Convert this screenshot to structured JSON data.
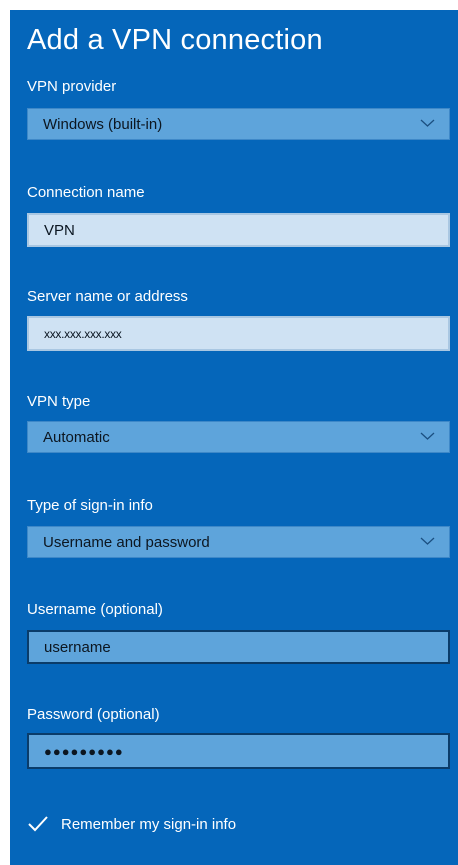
{
  "dialog": {
    "title": "Add a VPN connection"
  },
  "vpn_provider": {
    "label": "VPN provider",
    "value": "Windows (built-in)"
  },
  "connection_name": {
    "label": "Connection name",
    "value": "VPN"
  },
  "server": {
    "label": "Server name or address",
    "value": "xxx.xxx.xxx.xxx"
  },
  "vpn_type": {
    "label": "VPN type",
    "value": "Automatic"
  },
  "signin_type": {
    "label": "Type of sign-in info",
    "value": "Username and password"
  },
  "username": {
    "label": "Username (optional)",
    "value": "username"
  },
  "password": {
    "label": "Password (optional)",
    "value": "●●●●●●●●●"
  },
  "remember": {
    "label": "Remember my sign-in info",
    "checked": true
  },
  "colors": {
    "panel_bg": "#0566ba",
    "dropdown_bg": "#5ea4db",
    "input_light_bg": "#cfe2f3",
    "text_white": "#ffffff"
  },
  "icons": {
    "dropdown": "chevron-down-icon",
    "checkbox": "checkmark-icon"
  }
}
